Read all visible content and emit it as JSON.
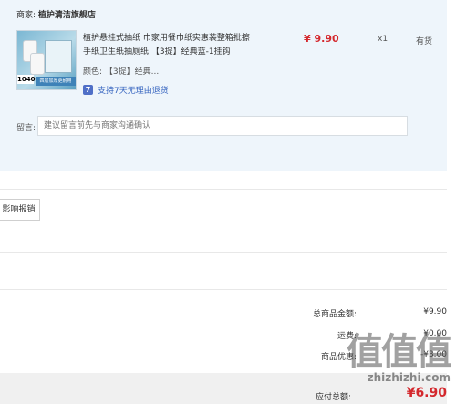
{
  "shop": {
    "label": "商家:",
    "name": "植护清洁旗舰店"
  },
  "product": {
    "thumb_badge": "1040",
    "thumb_caption": "四层加厚更耐用",
    "title": "植护悬挂式抽纸 巾家用餐巾纸实惠装整箱批擦手纸卫生纸抽厕纸 【3提】经典蓝-1挂钩",
    "price": "¥ 9.90",
    "qty": "x1",
    "stock": "有货",
    "spec": "颜色: 【3提】经典...",
    "return_icon": "7",
    "return_text": "支持7天无理由退货"
  },
  "message": {
    "label": "留言:",
    "placeholder": "建议留言前先与商家沟通确认"
  },
  "apply_button": "影响报销",
  "summary": {
    "total_goods_label": "总商品金额:",
    "total_goods": "¥9.90",
    "freight_label": "运费:",
    "freight": "¥0.00",
    "discount_label": "商品优惠:",
    "discount": "-¥3.00"
  },
  "pay": {
    "label": "应付总额:",
    "amount": "¥6.90"
  },
  "watermark": {
    "glyphs": "值值值",
    "site": "zhizhizhi.com"
  },
  "colors": {
    "panel_bg": "#eef5fb",
    "price_red": "#d4282d",
    "link_blue": "#3866c0"
  }
}
